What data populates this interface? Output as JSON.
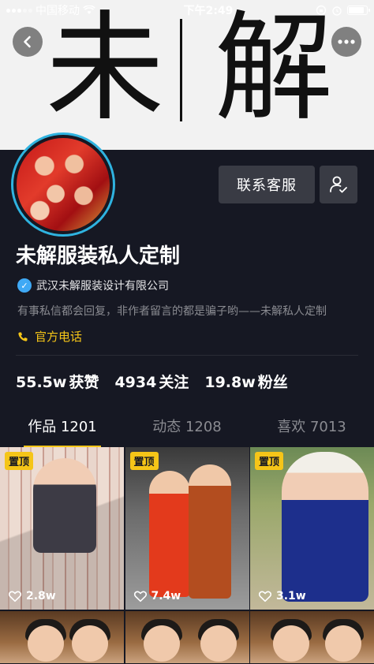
{
  "status_bar": {
    "carrier": "中国移动",
    "time": "下午2:49",
    "battery_level": 0.9
  },
  "banner": {
    "char_left": "未",
    "char_right": "解"
  },
  "profile": {
    "name": "未解服装私人定制",
    "verified_org": "武汉未解服装设计有限公司",
    "bio": "有事私信都会回复，非作者留言的都是骗子哟——未解私人定制",
    "phone_label": "官方电话"
  },
  "actions": {
    "contact_label": "联系客服"
  },
  "stats": [
    {
      "value": "55.5w",
      "label": "获赞"
    },
    {
      "value": "4934",
      "label": "关注"
    },
    {
      "value": "19.8w",
      "label": "粉丝"
    }
  ],
  "tabs": [
    {
      "label": "作品 1201",
      "active": true
    },
    {
      "label": "动态 1208",
      "active": false
    },
    {
      "label": "喜欢 7013",
      "active": false
    }
  ],
  "videos": [
    {
      "pinned_label": "置顶",
      "likes": "2.8w"
    },
    {
      "pinned_label": "置顶",
      "likes": "7.4w"
    },
    {
      "pinned_label": "置顶",
      "likes": "3.1w"
    }
  ],
  "colors": {
    "background": "#161823",
    "accent_yellow": "#f5c518",
    "verified_blue": "#3fa9f5",
    "avatar_ring": "#2fb3e0"
  },
  "icons": {
    "back": "chevron-left-icon",
    "more": "more-dots-icon",
    "follow": "user-check-icon",
    "verified": "verified-badge-icon",
    "phone": "phone-icon",
    "like": "heart-icon"
  }
}
